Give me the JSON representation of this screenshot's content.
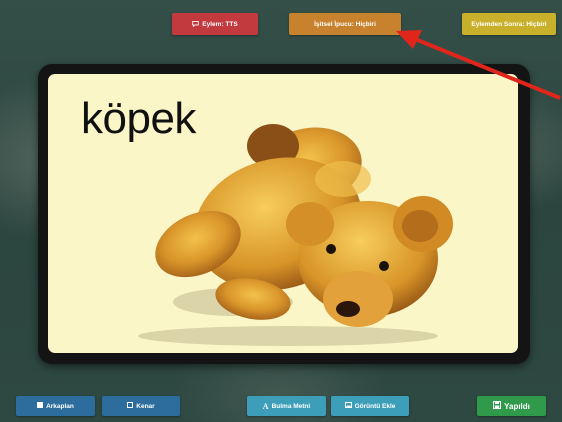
{
  "top_bar": {
    "action_label": "Eylem: TTS",
    "hint_label": "İşitsel İpucu: Hiçbiri",
    "next_label": "Eylemden Sonra: Hiçbiri"
  },
  "card": {
    "word": "köpek"
  },
  "bottom_bar": {
    "background_label": "Arkaplan",
    "border_label": "Kenar",
    "text_label": "Bulma Metni",
    "image_label": "Görüntü Ekle",
    "done_label": "Yapıldı"
  },
  "icons": {
    "action": "speech-bubble-icon",
    "background": "square-fill-icon",
    "border": "square-outline-icon",
    "text": "letter-a-icon",
    "image": "image-icon",
    "done": "save-icon"
  },
  "colors": {
    "action": "#c23a3e",
    "hint": "#c8822e",
    "next": "#c9b02a",
    "primary": "#2c6d9e",
    "secondary": "#3c9eb8",
    "done": "#2e9a4a",
    "card": "#fbf6c8",
    "arrow": "#e0261b"
  }
}
